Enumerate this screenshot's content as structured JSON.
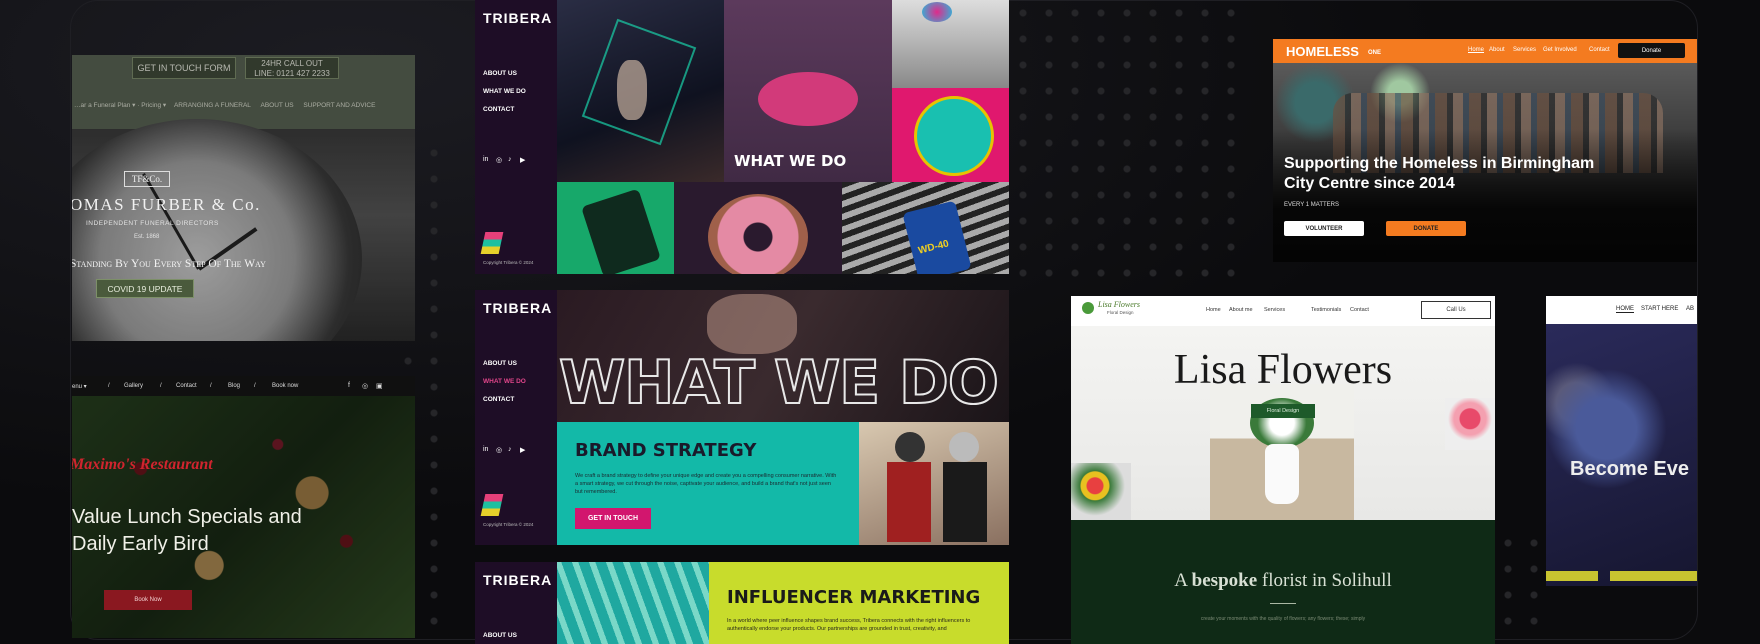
{
  "furber": {
    "touch_btn": "GET IN TOUCH FORM",
    "callout_line1": "24HR CALL OUT",
    "callout_line2": "LINE: 0121 427 2233",
    "nav": [
      "ARRANGING A FUNERAL",
      "ABOUT US",
      "SUPPORT AND ADVICE"
    ],
    "monogram": "TF&Co.",
    "name": "OMAS FURBER & Co.",
    "tagline": "INDEPENDENT FUNERAL DIRECTORS",
    "est": "Est. 1868",
    "motto": "Standing By You Every Step Of The Way",
    "covid_btn": "COVID 19 UPDATE"
  },
  "tribera": {
    "logo": "TRIBERA",
    "nav": [
      "ABOUT US",
      "WHAT WE DO",
      "CONTACT"
    ],
    "copyright": "Copyright Tribera © 2024",
    "what_we_do": "WHAT WE DO",
    "brand_title": "BRAND STRATEGY",
    "brand_body": "We craft a brand strategy to define your unique edge and create you a compelling consumer narrative. With a smart strategy, we cut through the noise, captivate your audience, and build a brand that's not just seen but remembered.",
    "get_in_touch": "GET IN TOUCH",
    "influencer_title": "INFLUENCER MARKETING",
    "influencer_body": "In a world where peer influence shapes brand success, Tribera connects with the right influencers to authentically endorse your products. Our partnerships are grounded in trust, creativity, and",
    "wd40": "WD-40"
  },
  "maximos": {
    "nav": [
      "Gallery",
      "Contact",
      "Blog",
      "Book now"
    ],
    "restaurant": "Maximo's Restaurant",
    "headline1": "Value Lunch Specials and",
    "headline2": "Daily Early Bird",
    "cta": "Book Now"
  },
  "homeless": {
    "logo": "HOMELESS",
    "logo_suffix": "ONE",
    "nav": [
      "Home",
      "About",
      "Services",
      "Get Involved",
      "Contact"
    ],
    "donate_nav": "Donate",
    "headline": "Supporting the Homeless in Birmingham City Centre since 2014",
    "sub": "EVERY 1 MATTERS",
    "volunteer": "VOLUNTEER",
    "donate": "DONATE"
  },
  "lisa": {
    "logo": "Lisa Flowers",
    "logo_sub": "Floral Design",
    "nav": [
      "Home",
      "About me",
      "Services",
      "Testimonials",
      "Contact"
    ],
    "call": "Call Us",
    "hero": "Lisa Flowers",
    "badge": "Floral Design",
    "bespoke_pre": "A",
    "bespoke_bold": "bespoke",
    "bespoke_post": "florist in Solihull",
    "small_text": "create your moments with the quality of flowers; any flowers; these; simply"
  },
  "right": {
    "nav": [
      "HOME",
      "START HERE",
      "AB"
    ],
    "headline": "Become Eve"
  },
  "colors": {
    "homeless_orange": "#f47b20",
    "tribera_pink": "#d2166e",
    "tribera_teal": "#13b9a8",
    "tribera_lime": "#c8dc2c",
    "furber_green": "#4a5a3c"
  }
}
